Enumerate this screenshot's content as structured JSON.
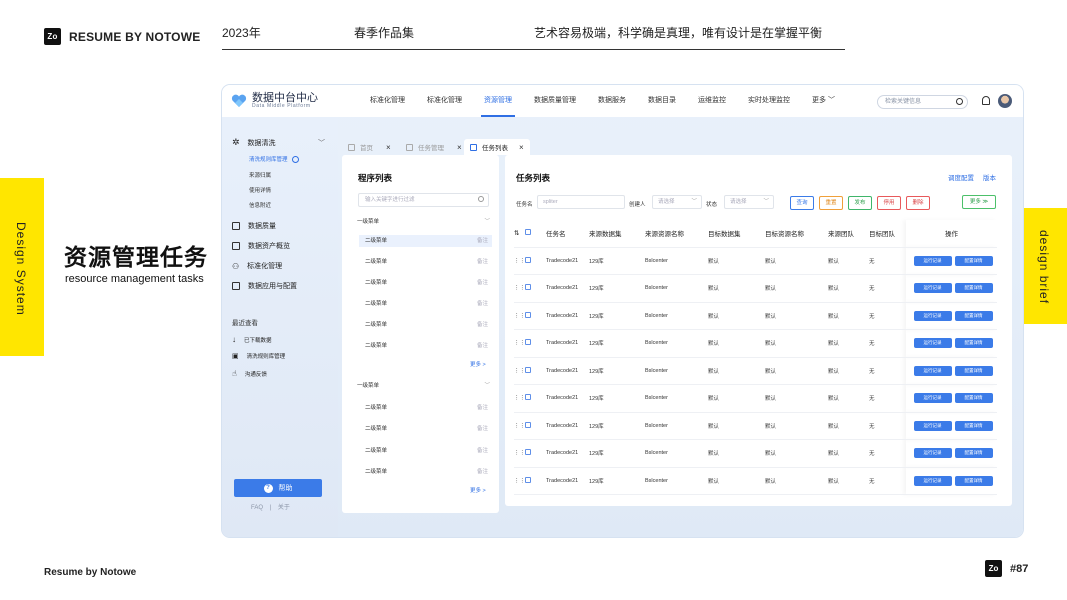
{
  "page": {
    "brand": "RESUME BY NOTOWE",
    "year": "2023年",
    "collection": "春季作品集",
    "motto": "艺术容易极端，科学确是真理，唯有设计是在掌握平衡",
    "left_tab": "Design System",
    "right_tab": "design brief",
    "title_cn": "资源管理任务",
    "title_en": "resource management tasks",
    "footer_left": "Resume by Notowe",
    "page_number": "#87",
    "logo_glyph": "Zo"
  },
  "app": {
    "name": "数据中台中心",
    "subname": "Data Middle Platform",
    "nav": [
      {
        "label": "标准化管理",
        "active": false
      },
      {
        "label": "标准化管理",
        "active": false
      },
      {
        "label": "资源管理",
        "active": true
      },
      {
        "label": "数据质量管理",
        "active": false
      },
      {
        "label": "数据服务",
        "active": false
      },
      {
        "label": "数据目录",
        "active": false
      },
      {
        "label": "运维监控",
        "active": false
      },
      {
        "label": "实时处理监控",
        "active": false
      },
      {
        "label": "更多 ﹀",
        "active": false
      }
    ],
    "search_placeholder": "检索关键信息",
    "accent": "#2f6fe4"
  },
  "sidebar": {
    "group1": "数据清洗",
    "group1_subs": [
      "清洗规则库管理",
      "来源归属",
      "使用详情",
      "信息附近"
    ],
    "items": [
      "数据质量",
      "数据资产概览",
      "标准化管理",
      "数据应用与配置"
    ],
    "recent_title": "最近查看",
    "recent": [
      "已下载数据",
      "清洗规则库管理",
      "沟通反馈"
    ],
    "help": "帮助",
    "help_glyph": "?",
    "footer": "FAQ    |    关于"
  },
  "tabs": [
    {
      "label": "首页"
    },
    {
      "label": "任务管理"
    },
    {
      "label": "任务列表"
    }
  ],
  "left_panel": {
    "title": "程序列表",
    "search_placeholder": "输入关键字进行过滤",
    "group_label": "一级菜单",
    "item_label": "二级菜单",
    "note": "备注",
    "more": "更多 >"
  },
  "right_panel": {
    "title": "任务列表",
    "links": [
      "调度配置",
      "版本"
    ],
    "filters": {
      "task_name_label": "任务名",
      "task_name_placeholder": "spliter",
      "creator_label": "创建人",
      "creator_placeholder": "请选择",
      "status_label": "状态",
      "status_placeholder": "请选择"
    },
    "buttons": [
      {
        "label": "查询",
        "color": "#3b7be8"
      },
      {
        "label": "重置",
        "color": "#f0a03a"
      },
      {
        "label": "发布",
        "color": "#3fb56a"
      },
      {
        "label": "停用",
        "color": "#e8595b"
      },
      {
        "label": "删除",
        "color": "#e8595b"
      }
    ],
    "more_button": "更多 ≫",
    "columns": [
      "任务名",
      "来源数据集",
      "来源资源名称",
      "目标数据集",
      "目标资源名称",
      "来源团队",
      "目标团队",
      "操作"
    ],
    "rows": [
      [
        "Tradecode21",
        "129库",
        "Bslcenter",
        "默认",
        "默认",
        "默认",
        "无"
      ],
      [
        "Tradecode21",
        "129库",
        "Bslcenter",
        "默认",
        "默认",
        "默认",
        "无"
      ],
      [
        "Tradecode21",
        "129库",
        "Bslcenter",
        "默认",
        "默认",
        "默认",
        "无"
      ],
      [
        "Tradecode21",
        "129库",
        "Bslcenter",
        "默认",
        "默认",
        "默认",
        "无"
      ],
      [
        "Tradecode21",
        "129库",
        "Bslcenter",
        "默认",
        "默认",
        "默认",
        "无"
      ],
      [
        "Tradecode21",
        "129库",
        "Bslcenter",
        "默认",
        "默认",
        "默认",
        "无"
      ],
      [
        "Tradecode21",
        "129库",
        "Bslcenter",
        "默认",
        "默认",
        "默认",
        "无"
      ],
      [
        "Tradecode21",
        "129库",
        "Bslcenter",
        "默认",
        "默认",
        "默认",
        "无"
      ],
      [
        "Tradecode21",
        "129库",
        "Bslcenter",
        "默认",
        "默认",
        "默认",
        "无"
      ]
    ],
    "action_run": "运行记录",
    "action_config": "配置详情"
  }
}
